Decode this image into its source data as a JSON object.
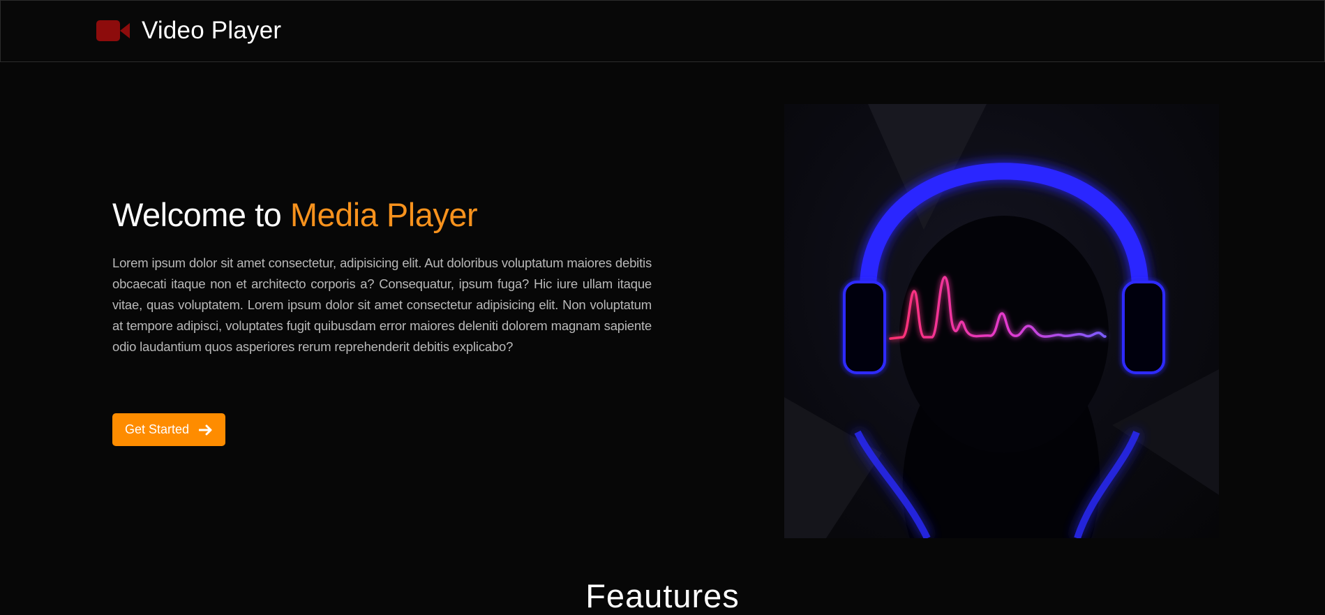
{
  "navbar": {
    "brand_icon": "video-camera-icon",
    "brand_name": "Video Player",
    "brand_color": "#8d0c0c"
  },
  "hero": {
    "title_prefix": "Welcome to ",
    "title_accent": "Media Player",
    "accent_color": "#f7921d",
    "description": "Lorem ipsum dolor sit amet consectetur, adipisicing elit. Aut doloribus voluptatum maiores debitis obcaecati itaque non et architecto corporis a? Consequatur, ipsum fuga? Hic iure ullam itaque vitae, quas voluptatem. Lorem ipsum dolor sit amet consectetur adipisicing elit. Non voluptatum at tempore adipisci, voluptates fugit quibusdam error maiores deleniti dolorem magnam sapiente odio laudantium quos asperiores rerum reprehenderit debitis explicabo?",
    "cta_label": "Get Started",
    "cta_icon": "arrow-right-icon",
    "cta_color": "#fe8c00",
    "image": "headphones-neon-waveform-illustration"
  },
  "features": {
    "title": "Feautures"
  }
}
